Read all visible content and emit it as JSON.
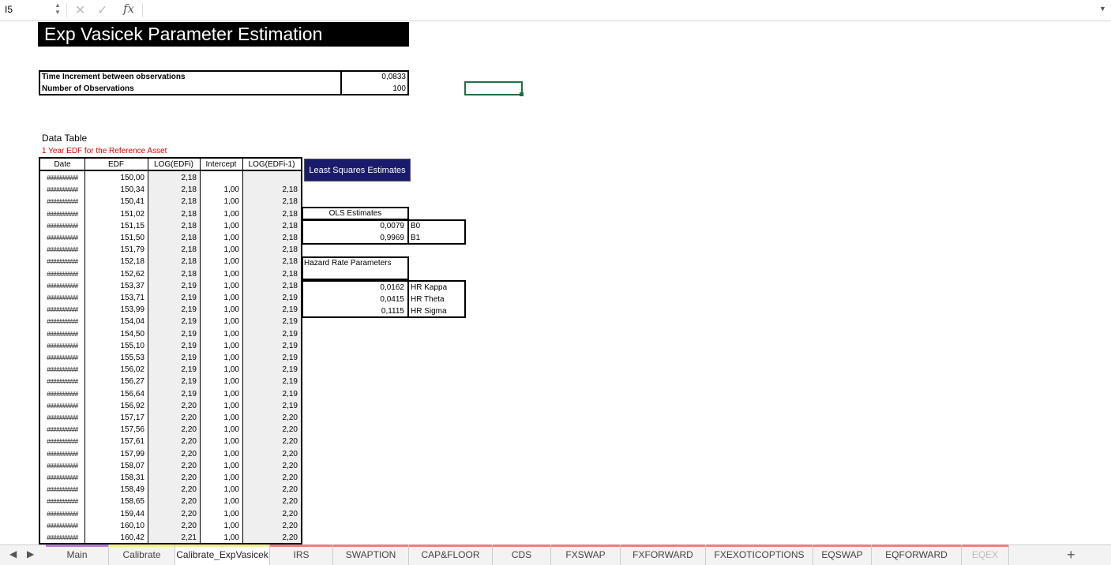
{
  "formula_bar": {
    "cell_ref": "I5",
    "value": ""
  },
  "sheet": {
    "title": "Exp Vasicek Parameter Estimation",
    "params": [
      {
        "label": "Time Increment between observations",
        "value": "0,0833"
      },
      {
        "label": "Number of Observations",
        "value": "100"
      }
    ],
    "data_table": {
      "title": "Data Table",
      "subtitle": "1 Year EDF for the Reference Asset",
      "headers": [
        "Date",
        "EDF",
        "LOG(EDFi)",
        "Intercept",
        "LOG(EDFi-1)"
      ],
      "rows": [
        [
          "##########",
          "150,00",
          "2,18",
          "",
          ""
        ],
        [
          "##########",
          "150,34",
          "2,18",
          "1,00",
          "2,18"
        ],
        [
          "##########",
          "150,41",
          "2,18",
          "1,00",
          "2,18"
        ],
        [
          "##########",
          "151,02",
          "2,18",
          "1,00",
          "2,18"
        ],
        [
          "##########",
          "151,15",
          "2,18",
          "1,00",
          "2,18"
        ],
        [
          "##########",
          "151,50",
          "2,18",
          "1,00",
          "2,18"
        ],
        [
          "##########",
          "151,79",
          "2,18",
          "1,00",
          "2,18"
        ],
        [
          "##########",
          "152,18",
          "2,18",
          "1,00",
          "2,18"
        ],
        [
          "##########",
          "152,62",
          "2,18",
          "1,00",
          "2,18"
        ],
        [
          "##########",
          "153,37",
          "2,19",
          "1,00",
          "2,18"
        ],
        [
          "##########",
          "153,71",
          "2,19",
          "1,00",
          "2,19"
        ],
        [
          "##########",
          "153,99",
          "2,19",
          "1,00",
          "2,19"
        ],
        [
          "##########",
          "154,04",
          "2,19",
          "1,00",
          "2,19"
        ],
        [
          "##########",
          "154,50",
          "2,19",
          "1,00",
          "2,19"
        ],
        [
          "##########",
          "155,10",
          "2,19",
          "1,00",
          "2,19"
        ],
        [
          "##########",
          "155,53",
          "2,19",
          "1,00",
          "2,19"
        ],
        [
          "##########",
          "156,02",
          "2,19",
          "1,00",
          "2,19"
        ],
        [
          "##########",
          "156,27",
          "2,19",
          "1,00",
          "2,19"
        ],
        [
          "##########",
          "156,64",
          "2,19",
          "1,00",
          "2,19"
        ],
        [
          "##########",
          "156,92",
          "2,20",
          "1,00",
          "2,19"
        ],
        [
          "##########",
          "157,17",
          "2,20",
          "1,00",
          "2,20"
        ],
        [
          "##########",
          "157,56",
          "2,20",
          "1,00",
          "2,20"
        ],
        [
          "##########",
          "157,61",
          "2,20",
          "1,00",
          "2,20"
        ],
        [
          "##########",
          "157,99",
          "2,20",
          "1,00",
          "2,20"
        ],
        [
          "##########",
          "158,07",
          "2,20",
          "1,00",
          "2,20"
        ],
        [
          "##########",
          "158,31",
          "2,20",
          "1,00",
          "2,20"
        ],
        [
          "##########",
          "158,49",
          "2,20",
          "1,00",
          "2,20"
        ],
        [
          "##########",
          "158,65",
          "2,20",
          "1,00",
          "2,20"
        ],
        [
          "##########",
          "159,44",
          "2,20",
          "1,00",
          "2,20"
        ],
        [
          "##########",
          "160,10",
          "2,20",
          "1,00",
          "2,20"
        ],
        [
          "##########",
          "160,42",
          "2,21",
          "1,00",
          "2,20"
        ]
      ]
    },
    "button_label": "Least Squares Estimates",
    "ols": {
      "title": "OLS Estimates",
      "rows": [
        {
          "value": "0,0079",
          "label": "B0"
        },
        {
          "value": "0,9969",
          "label": "B1"
        }
      ]
    },
    "hazard": {
      "title": "Hazard Rate Parameters",
      "rows": [
        {
          "value": "0,0162",
          "label": "HR Kappa"
        },
        {
          "value": "0,0415",
          "label": "HR Theta"
        },
        {
          "value": "0,1115",
          "label": "HR Sigma"
        }
      ]
    }
  },
  "tabs": [
    {
      "label": "Main",
      "color": "#b57bd1"
    },
    {
      "label": "Calibrate",
      "color": "#f2ee8c"
    },
    {
      "label": "Calibrate_ExpVasicek",
      "color": "#f2ee8c",
      "active": true
    },
    {
      "label": "IRS",
      "color": "#e8817f"
    },
    {
      "label": "SWAPTION",
      "color": "#e8817f"
    },
    {
      "label": "CAP&FLOOR",
      "color": "#e8817f"
    },
    {
      "label": "CDS",
      "color": "#e8817f"
    },
    {
      "label": "FXSWAP",
      "color": "#e8817f"
    },
    {
      "label": "FXFORWARD",
      "color": "#e8817f"
    },
    {
      "label": "FXEXOTICOPTIONS",
      "color": "#e8817f"
    },
    {
      "label": "EQSWAP",
      "color": "#e8817f"
    },
    {
      "label": "EQFORWARD",
      "color": "#e8817f"
    },
    {
      "label": "EQEX",
      "color": "#e8817f"
    }
  ]
}
